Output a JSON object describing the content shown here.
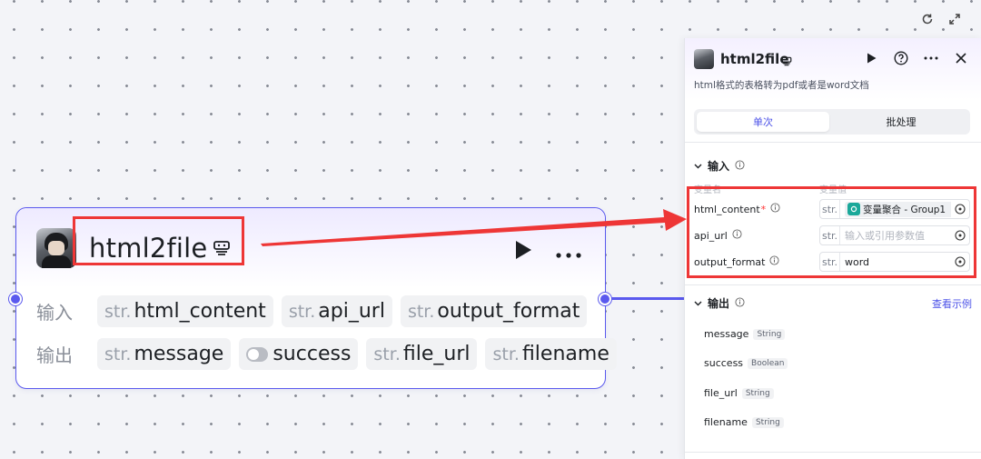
{
  "node": {
    "title": "html2file",
    "inputs_label": "输入",
    "outputs_label": "输出",
    "inputs": [
      {
        "type": "str.",
        "name": "html_content"
      },
      {
        "type": "str.",
        "name": "api_url"
      },
      {
        "type": "str.",
        "name": "output_format"
      }
    ],
    "outputs": [
      {
        "type": "str.",
        "name": "message"
      },
      {
        "type": "toggle",
        "name": "success"
      },
      {
        "type": "str.",
        "name": "file_url"
      },
      {
        "type": "str.",
        "name": "filename"
      }
    ]
  },
  "panel": {
    "title": "html2file",
    "description": "html格式的表格转为pdf或者是word文档",
    "tabs": {
      "single": "单次",
      "batch": "批处理"
    },
    "input_section": "输入",
    "col_var_name": "变量名",
    "col_var_value": "变量值",
    "params": [
      {
        "name": "html_content",
        "required": "*",
        "type": "str.",
        "chip": "变量聚合 - Group1"
      },
      {
        "name": "api_url",
        "type": "str.",
        "placeholder": "输入或引用参数值"
      },
      {
        "name": "output_format",
        "type": "str.",
        "value": "word"
      }
    ],
    "output_section": "输出",
    "see_example": "查看示例",
    "outputs": [
      {
        "name": "message",
        "type": "String"
      },
      {
        "name": "success",
        "type": "Boolean"
      },
      {
        "name": "file_url",
        "type": "String"
      },
      {
        "name": "filename",
        "type": "String"
      }
    ]
  },
  "colors": {
    "accent": "#5a59ee",
    "highlight": "#ee3636",
    "link": "#4d53e8"
  }
}
